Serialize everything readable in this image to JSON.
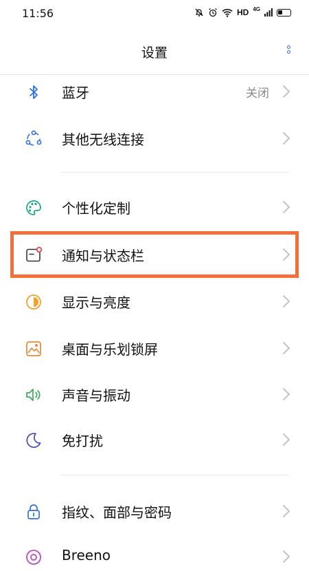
{
  "status_bar": {
    "time": "11:56",
    "hd": "HD",
    "net": "4G"
  },
  "header": {
    "title": "设置"
  },
  "rows": [
    {
      "id": "bluetooth",
      "label": "蓝牙",
      "value": "关闭",
      "icon": "bluetooth-icon"
    },
    {
      "id": "wireless",
      "label": "其他无线连接",
      "icon": "wireless-connection-icon"
    },
    {
      "id": "personalize",
      "label": "个性化定制",
      "icon": "palette-icon"
    },
    {
      "id": "notification",
      "label": "通知与状态栏",
      "icon": "notification-icon"
    },
    {
      "id": "display",
      "label": "显示与亮度",
      "icon": "brightness-icon"
    },
    {
      "id": "wallpaper",
      "label": "桌面与乐划锁屏",
      "icon": "wallpaper-icon"
    },
    {
      "id": "sound",
      "label": "声音与振动",
      "icon": "speaker-icon"
    },
    {
      "id": "dnd",
      "label": "免打扰",
      "icon": "moon-icon"
    },
    {
      "id": "security",
      "label": "指纹、面部与密码",
      "icon": "lock-icon"
    },
    {
      "id": "breeno",
      "label": "Breeno",
      "icon": "breeno-icon"
    }
  ],
  "colors": {
    "accent": "#2f6fe0",
    "highlight": "#f26f3a"
  }
}
